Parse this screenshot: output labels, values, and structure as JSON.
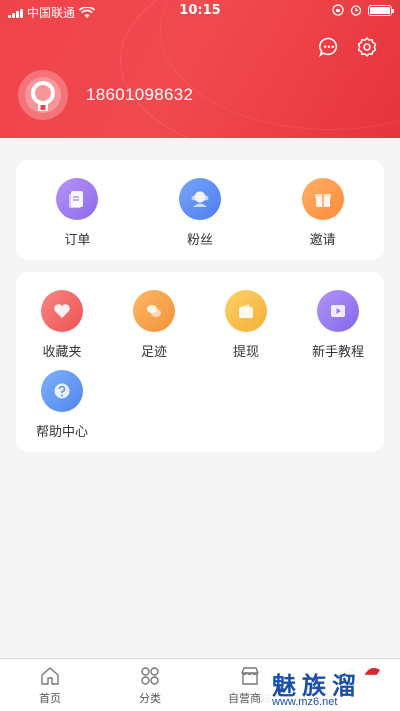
{
  "status_bar": {
    "carrier": "中国联通",
    "time": "10:15"
  },
  "header": {
    "phone": "18601098632",
    "icons": [
      "message-icon",
      "settings-icon"
    ]
  },
  "quick_links": [
    {
      "label": "订单",
      "icon": "order-icon",
      "color": "#a07df0"
    },
    {
      "label": "粉丝",
      "icon": "fans-icon",
      "color": "#5b8df5"
    },
    {
      "label": "邀请",
      "icon": "gift-icon",
      "color": "#ff9a4a"
    }
  ],
  "services": [
    {
      "label": "收藏夹",
      "icon": "heart-icon",
      "color": "#f26464"
    },
    {
      "label": "足迹",
      "icon": "footprint-icon",
      "color": "#f9a54c"
    },
    {
      "label": "提现",
      "icon": "wallet-icon",
      "color": "#f7c04a"
    },
    {
      "label": "新手教程",
      "icon": "video-icon",
      "color": "#9a7df2"
    },
    {
      "label": "帮助中心",
      "icon": "help-icon",
      "color": "#5f95f2"
    }
  ],
  "tabbar": [
    {
      "label": "首页",
      "icon": "home-icon"
    },
    {
      "label": "分类",
      "icon": "category-icon"
    },
    {
      "label": "自营商城",
      "icon": "store-icon"
    }
  ],
  "watermark": {
    "title": "魅族溜",
    "url": "www.mz6.net"
  }
}
